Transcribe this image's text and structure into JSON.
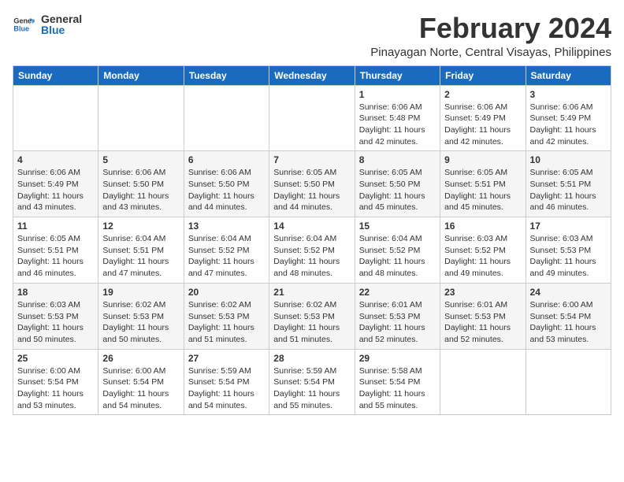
{
  "logo": {
    "line1": "General",
    "line2": "Blue"
  },
  "title": "February 2024",
  "subtitle": "Pinayagan Norte, Central Visayas, Philippines",
  "headers": [
    "Sunday",
    "Monday",
    "Tuesday",
    "Wednesday",
    "Thursday",
    "Friday",
    "Saturday"
  ],
  "weeks": [
    [
      {
        "day": "",
        "info": ""
      },
      {
        "day": "",
        "info": ""
      },
      {
        "day": "",
        "info": ""
      },
      {
        "day": "",
        "info": ""
      },
      {
        "day": "1",
        "info": "Sunrise: 6:06 AM\nSunset: 5:48 PM\nDaylight: 11 hours and 42 minutes."
      },
      {
        "day": "2",
        "info": "Sunrise: 6:06 AM\nSunset: 5:49 PM\nDaylight: 11 hours and 42 minutes."
      },
      {
        "day": "3",
        "info": "Sunrise: 6:06 AM\nSunset: 5:49 PM\nDaylight: 11 hours and 42 minutes."
      }
    ],
    [
      {
        "day": "4",
        "info": "Sunrise: 6:06 AM\nSunset: 5:49 PM\nDaylight: 11 hours and 43 minutes."
      },
      {
        "day": "5",
        "info": "Sunrise: 6:06 AM\nSunset: 5:50 PM\nDaylight: 11 hours and 43 minutes."
      },
      {
        "day": "6",
        "info": "Sunrise: 6:06 AM\nSunset: 5:50 PM\nDaylight: 11 hours and 44 minutes."
      },
      {
        "day": "7",
        "info": "Sunrise: 6:05 AM\nSunset: 5:50 PM\nDaylight: 11 hours and 44 minutes."
      },
      {
        "day": "8",
        "info": "Sunrise: 6:05 AM\nSunset: 5:50 PM\nDaylight: 11 hours and 45 minutes."
      },
      {
        "day": "9",
        "info": "Sunrise: 6:05 AM\nSunset: 5:51 PM\nDaylight: 11 hours and 45 minutes."
      },
      {
        "day": "10",
        "info": "Sunrise: 6:05 AM\nSunset: 5:51 PM\nDaylight: 11 hours and 46 minutes."
      }
    ],
    [
      {
        "day": "11",
        "info": "Sunrise: 6:05 AM\nSunset: 5:51 PM\nDaylight: 11 hours and 46 minutes."
      },
      {
        "day": "12",
        "info": "Sunrise: 6:04 AM\nSunset: 5:51 PM\nDaylight: 11 hours and 47 minutes."
      },
      {
        "day": "13",
        "info": "Sunrise: 6:04 AM\nSunset: 5:52 PM\nDaylight: 11 hours and 47 minutes."
      },
      {
        "day": "14",
        "info": "Sunrise: 6:04 AM\nSunset: 5:52 PM\nDaylight: 11 hours and 48 minutes."
      },
      {
        "day": "15",
        "info": "Sunrise: 6:04 AM\nSunset: 5:52 PM\nDaylight: 11 hours and 48 minutes."
      },
      {
        "day": "16",
        "info": "Sunrise: 6:03 AM\nSunset: 5:52 PM\nDaylight: 11 hours and 49 minutes."
      },
      {
        "day": "17",
        "info": "Sunrise: 6:03 AM\nSunset: 5:53 PM\nDaylight: 11 hours and 49 minutes."
      }
    ],
    [
      {
        "day": "18",
        "info": "Sunrise: 6:03 AM\nSunset: 5:53 PM\nDaylight: 11 hours and 50 minutes."
      },
      {
        "day": "19",
        "info": "Sunrise: 6:02 AM\nSunset: 5:53 PM\nDaylight: 11 hours and 50 minutes."
      },
      {
        "day": "20",
        "info": "Sunrise: 6:02 AM\nSunset: 5:53 PM\nDaylight: 11 hours and 51 minutes."
      },
      {
        "day": "21",
        "info": "Sunrise: 6:02 AM\nSunset: 5:53 PM\nDaylight: 11 hours and 51 minutes."
      },
      {
        "day": "22",
        "info": "Sunrise: 6:01 AM\nSunset: 5:53 PM\nDaylight: 11 hours and 52 minutes."
      },
      {
        "day": "23",
        "info": "Sunrise: 6:01 AM\nSunset: 5:53 PM\nDaylight: 11 hours and 52 minutes."
      },
      {
        "day": "24",
        "info": "Sunrise: 6:00 AM\nSunset: 5:54 PM\nDaylight: 11 hours and 53 minutes."
      }
    ],
    [
      {
        "day": "25",
        "info": "Sunrise: 6:00 AM\nSunset: 5:54 PM\nDaylight: 11 hours and 53 minutes."
      },
      {
        "day": "26",
        "info": "Sunrise: 6:00 AM\nSunset: 5:54 PM\nDaylight: 11 hours and 54 minutes."
      },
      {
        "day": "27",
        "info": "Sunrise: 5:59 AM\nSunset: 5:54 PM\nDaylight: 11 hours and 54 minutes."
      },
      {
        "day": "28",
        "info": "Sunrise: 5:59 AM\nSunset: 5:54 PM\nDaylight: 11 hours and 55 minutes."
      },
      {
        "day": "29",
        "info": "Sunrise: 5:58 AM\nSunset: 5:54 PM\nDaylight: 11 hours and 55 minutes."
      },
      {
        "day": "",
        "info": ""
      },
      {
        "day": "",
        "info": ""
      }
    ]
  ]
}
